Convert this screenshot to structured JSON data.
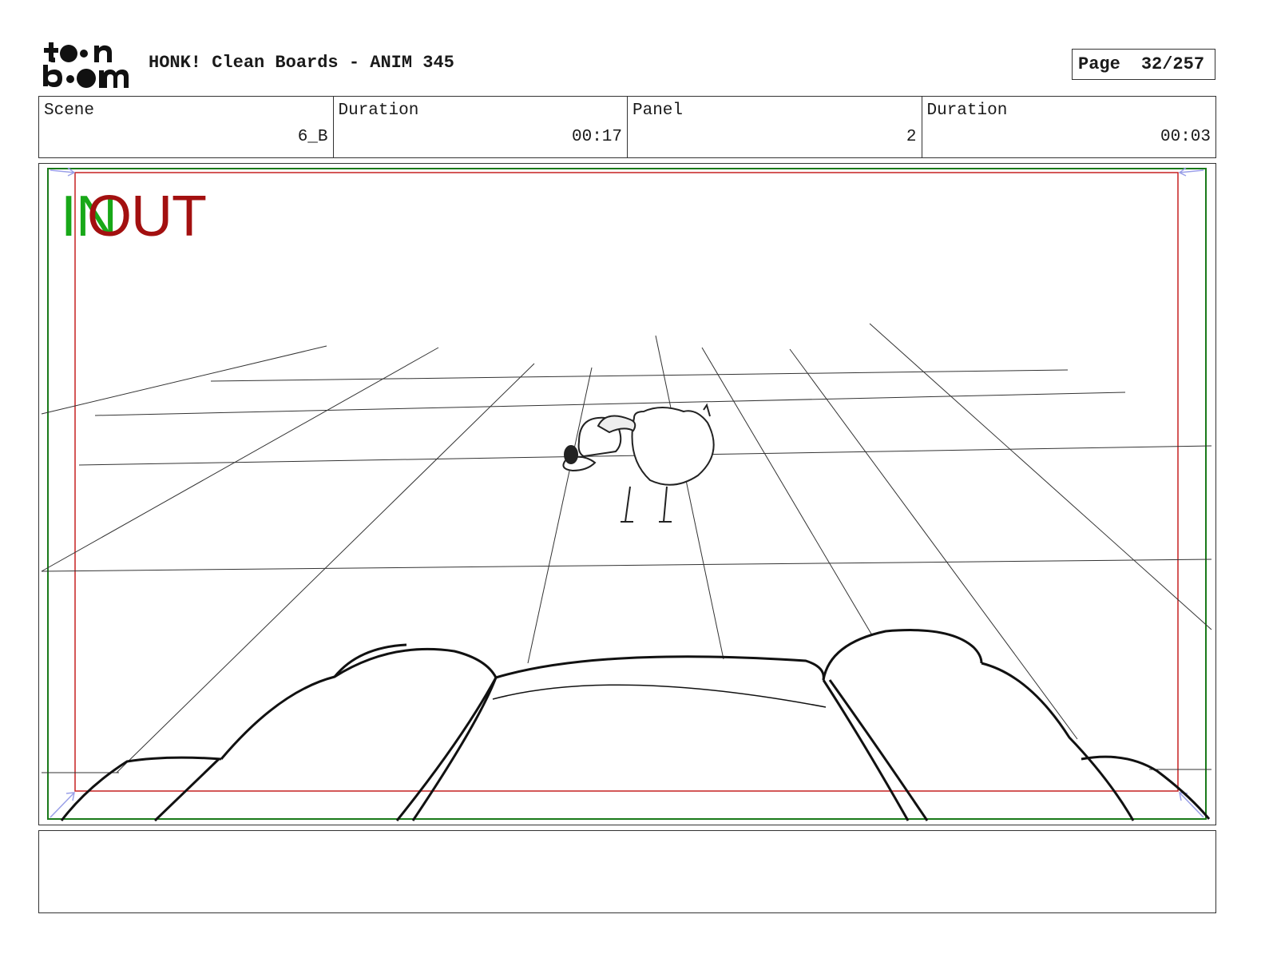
{
  "header": {
    "logo_text": "toon boom",
    "title": "HONK! Clean Boards - ANIM 345",
    "page_label": "Page",
    "page_value": "32/257"
  },
  "info": {
    "scene_label": "Scene",
    "scene_value": "6_B",
    "scene_duration_label": "Duration",
    "scene_duration_value": "00:17",
    "panel_label": "Panel",
    "panel_value": "2",
    "panel_duration_label": "Duration",
    "panel_duration_value": "00:03"
  },
  "panel": {
    "in_label": "IN",
    "out_label": "OUT",
    "in_color": "#18a818",
    "out_color": "#a31010",
    "safe_frame_color": "#1a7a1a"
  },
  "notes": {
    "text": ""
  }
}
